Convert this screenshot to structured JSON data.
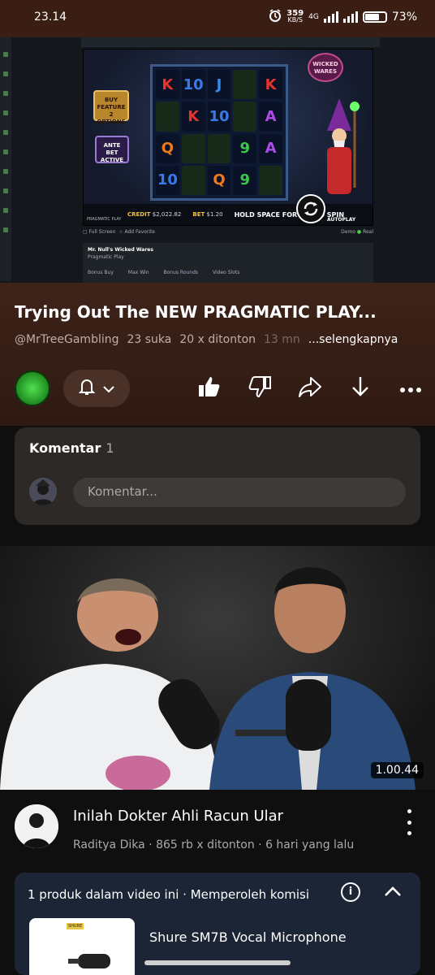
{
  "status_bar": {
    "time": "23.14",
    "net_speed_value": "359",
    "net_speed_unit": "KB/S",
    "network_label": "4G",
    "battery": "73%"
  },
  "player": {
    "game": {
      "buy_feature": "BUY FEATURE",
      "buy_feature_sub": "2 OPTIONS",
      "ante_bet": "ANTE BET",
      "ante_active": "ACTIVE",
      "logo": "WICKED WARES",
      "credit_label": "CREDIT",
      "credit_value": "$2,022.82",
      "bet_label": "BET",
      "bet_value": "$1.20",
      "hold_space": "HOLD SPACE FOR TURBO SPIN",
      "autoplay": "AUTOPLAY",
      "brand": "PRAGMATIC PLAY",
      "reel_symbols": [
        "K",
        "10",
        "J",
        "",
        "K",
        "",
        "K",
        "10",
        "",
        "A",
        "Q",
        "",
        "",
        "9",
        "A",
        "10",
        "",
        "Q",
        "9",
        ""
      ]
    },
    "below": {
      "full_screen": "Full Screen",
      "add_favorite": "Add Favorite",
      "demo": "Demo",
      "real": "Real",
      "game_title": "Mr. Null's Wicked Wares",
      "provider": "Pragmatic Play",
      "tabs": [
        "Bonus Buy",
        "Max Win",
        "Bonus Rounds",
        "Video Slots"
      ]
    }
  },
  "video": {
    "title": "Trying Out The NEW PRAGMATIC PLAY...",
    "channel": "@MrTreeGambling",
    "likes": "23 suka",
    "views": "20 x ditonton",
    "age": "13 mn",
    "more": "...selengkapnya"
  },
  "comments": {
    "label": "Komentar",
    "count": "1",
    "placeholder": "Komentar..."
  },
  "recommended": {
    "duration": "1.00.44",
    "title": "Inilah Dokter Ahli Racun Ular",
    "channel": "Raditya Dika",
    "views": "865 rb x ditonton",
    "age": "6 hari yang lalu",
    "separator": "·"
  },
  "products": {
    "label": "1 produk dalam video ini",
    "commission": "Memperoleh komisi",
    "separator": "·",
    "item_name": "Shure SM7B Vocal Microphone",
    "thumb_brand": "SHURE"
  },
  "colors": {
    "accent_green": "#3fd23f",
    "background": "#0f0f0f",
    "header_brown": "#3a1e14"
  }
}
